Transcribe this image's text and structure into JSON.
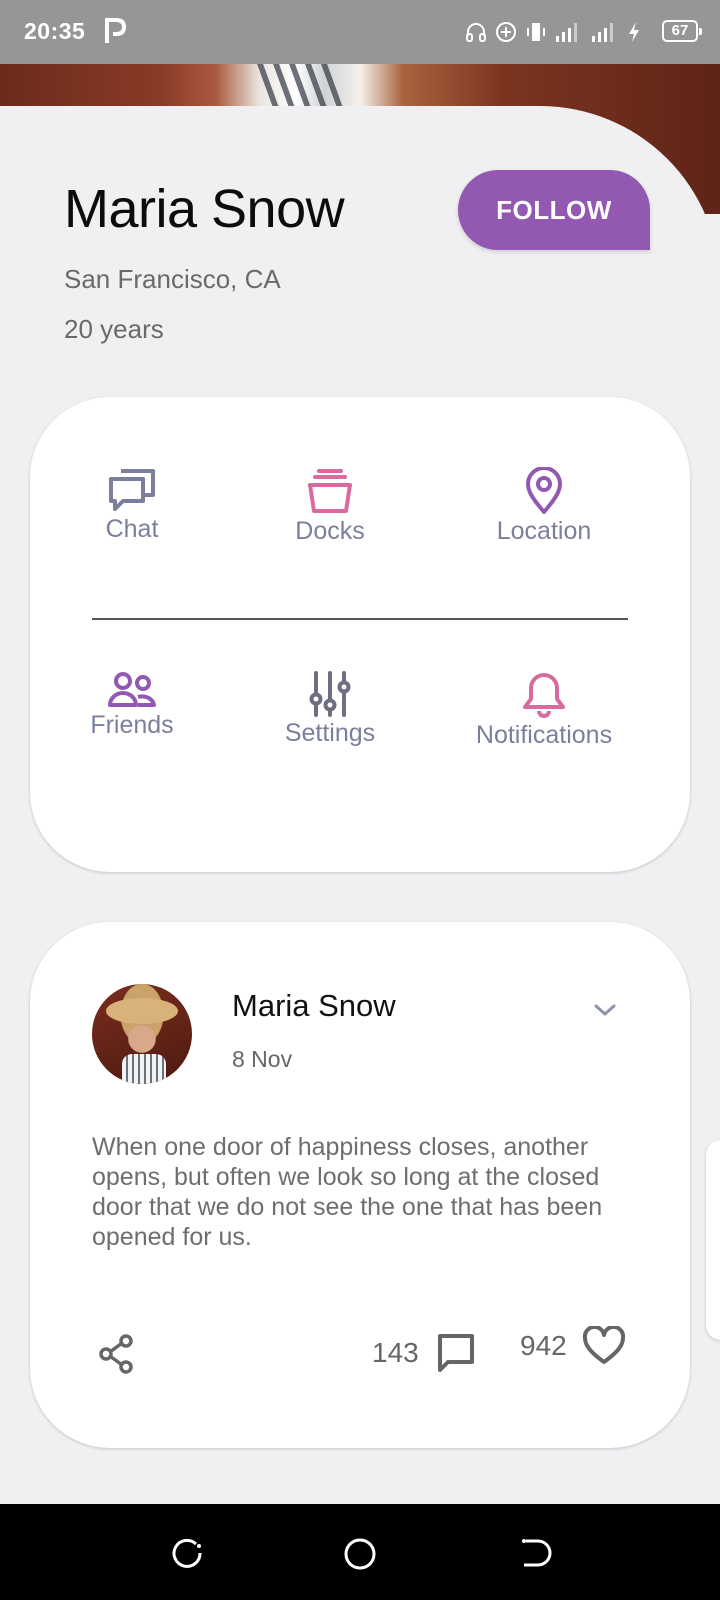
{
  "status_bar": {
    "time": "20:35",
    "battery": "67",
    "icons": [
      "parking-icon",
      "headset-icon",
      "data-saver-icon",
      "vibrate-icon",
      "signal-icon",
      "signal-icon",
      "charging-icon",
      "battery-icon"
    ]
  },
  "profile": {
    "name": "Maria Snow",
    "location": "San Francisco, CA",
    "age": "20 years",
    "follow_label": "FOLLOW"
  },
  "menu": {
    "items": [
      {
        "label": "Chat",
        "icon": "chat-icon",
        "color": "#7a7f9c"
      },
      {
        "label": "Docks",
        "icon": "basket-icon",
        "color": "#d96aa0"
      },
      {
        "label": "Location",
        "icon": "location-pin-icon",
        "color": "#9358b1"
      },
      {
        "label": "Friends",
        "icon": "friends-icon",
        "color": "#9358b1"
      },
      {
        "label": "Settings",
        "icon": "sliders-icon",
        "color": "#6e6e82"
      },
      {
        "label": "Notifications",
        "icon": "bell-icon",
        "color": "#d96aa0"
      }
    ]
  },
  "post": {
    "author": "Maria Snow",
    "date": "8 Nov",
    "text": "When one door of happiness closes, another opens, but often we look so long at the closed door that we do not see the one that has been opened for us.",
    "comments": "143",
    "likes": "942"
  },
  "colors": {
    "accent": "#9358b1",
    "pink": "#d96aa0",
    "label": "#7a7f9c"
  }
}
